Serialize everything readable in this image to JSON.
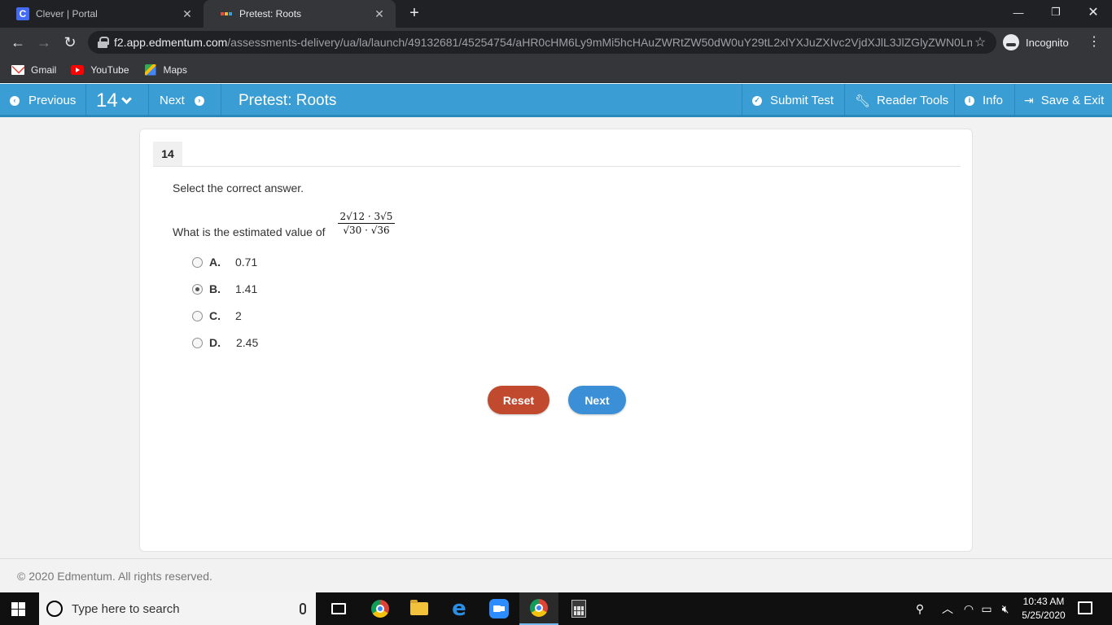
{
  "browser": {
    "tabs": [
      {
        "title": "Clever | Portal",
        "favicon_letter": "C"
      },
      {
        "title": "Pretest: Roots"
      }
    ],
    "url_host": "f2.app.edmentum.com",
    "url_path": "/assessments-delivery/ua/la/launch/49132681/45254754/aHR0cHM6Ly9mMi5hcHAuZWRtZW50dW0uY29tL2xlYXJuZXIvc2VjdXJlL3JlZGlyZWN0LmFzcHg/dXJsPS9sZWFybmVyL3NlY3VyZS9zaG93LmFzcHgjL2F#",
    "profile_label": "Incognito",
    "bookmarks": [
      {
        "label": "Gmail",
        "icon": "gmail-icon"
      },
      {
        "label": "YouTube",
        "icon": "youtube-icon"
      },
      {
        "label": "Maps",
        "icon": "maps-icon"
      }
    ]
  },
  "header": {
    "previous_label": "Previous",
    "question_number": "14",
    "next_label": "Next",
    "title": "Pretest: Roots",
    "submit_label": "Submit Test",
    "reader_tools_label": "Reader Tools",
    "info_label": "Info",
    "save_exit_label": "Save & Exit",
    "accent_color": "#3a9ed4"
  },
  "question": {
    "number": "14",
    "instruction": "Select the correct answer.",
    "prompt": "What is the estimated value of",
    "numerator": "2√12 · 3√5",
    "denominator": "√30 · √36",
    "options": [
      {
        "letter": "A.",
        "value": "0.71",
        "selected": false
      },
      {
        "letter": "B.",
        "value": "1.41",
        "selected": true
      },
      {
        "letter": "C.",
        "value": "2",
        "selected": false
      },
      {
        "letter": "D.",
        "value": "2.45",
        "selected": false
      }
    ],
    "reset_label": "Reset",
    "next_label": "Next"
  },
  "footer": {
    "copyright": "© 2020 Edmentum. All rights reserved."
  },
  "taskbar": {
    "search_placeholder": "Type here to search",
    "time": "10:43 AM",
    "date": "5/25/2020"
  }
}
